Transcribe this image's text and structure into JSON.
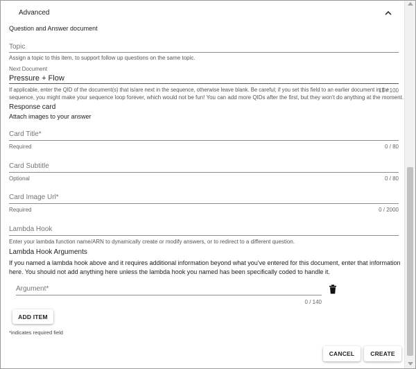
{
  "advanced": {
    "label": "Advanced"
  },
  "doc_type": "Question and Answer document",
  "topic": {
    "label": "Topic",
    "helper": "Assign a topic to this item, to support follow up questions on the same topic."
  },
  "next_document": {
    "label": "Next Document",
    "value": "Pressure + Flow",
    "helper_line1": "If applicable, enter the QID of the document(s) that is/are next in the sequence, otherwise leave blank. Be careful; if you set this field to an earlier document in the",
    "helper_line2": "sequence, you might make your sequence loop forever, which would not be fun! You can add more QIDs after the first, but they won't do anything at the moment.",
    "counter": "15 / 100"
  },
  "response_card": {
    "title": "Response card",
    "subtitle": "Attach images to your answer"
  },
  "card_title": {
    "label": "Card Title*",
    "helper": "Required",
    "counter": "0 / 80"
  },
  "card_subtitle": {
    "label": "Card Subtitle",
    "helper": "Optional",
    "counter": "0 / 80"
  },
  "card_image_url": {
    "label": "Card Image Url*",
    "helper": "Required",
    "counter": "0 / 2000"
  },
  "lambda_hook": {
    "label": "Lambda Hook",
    "helper": "Enter your lambda function name/ARN to dynamically create or modify answers, or to redirect to a different question."
  },
  "lambda_args": {
    "title": "Lambda Hook Arguments",
    "desc_line1": "If you named a lambda hook above and it requires additional information beyond what you've entered for this document, enter that information",
    "desc_line2": "here. You should not add anything here unless the lambda hook you named has been specifically coded to handle it."
  },
  "argument": {
    "label": "Argument*",
    "counter": "0 / 140"
  },
  "add_item_label": "ADD ITEM",
  "required_note": "*indicates required field",
  "actions": {
    "cancel": "CANCEL",
    "create": "CREATE"
  }
}
